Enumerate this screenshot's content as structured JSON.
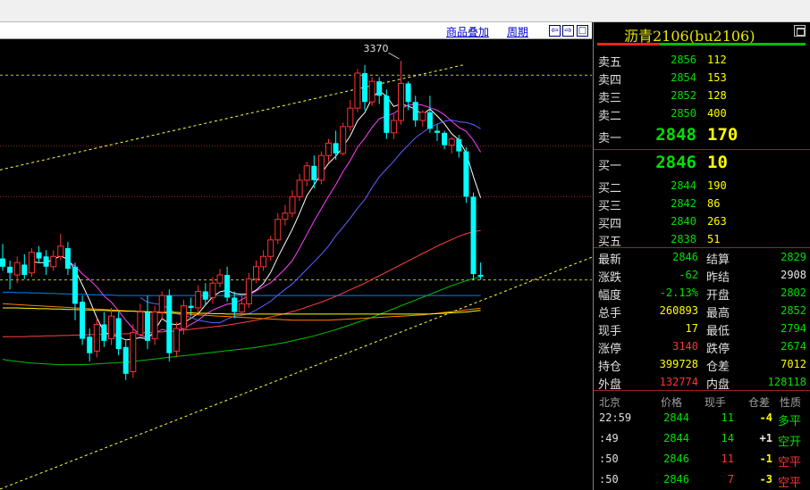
{
  "toolbar": {
    "overlay_label": "商品叠加",
    "period_label": "周期",
    "nav_buttons": [
      "⇦",
      "⇨",
      "□"
    ]
  },
  "colors": {
    "up": "#ff3232",
    "down": "#00ffff",
    "ma5": "#ffffff",
    "ma10": "#ff40ff",
    "ma20": "#6060ff",
    "ma40": "#ff4040",
    "ma60": "#00c000",
    "ma120": "#0080ff",
    "ma250": "#ff8000",
    "ma_long": "#ffff00",
    "trend": "#ffff40"
  },
  "chart_data": {
    "type": "candlestick",
    "y_range": [
      2330,
      3420
    ],
    "high_label": "3370",
    "reference_levels": [
      3335,
      3163,
      3040,
      2838
    ],
    "trend_lines": [
      {
        "name": "upper",
        "from": [
          0,
          3105
        ],
        "to": [
          64,
          3360
        ]
      },
      {
        "name": "lower",
        "from": [
          0,
          2330
        ],
        "to": [
          90,
          2950
        ]
      }
    ],
    "candles": [
      [
        2890,
        2870,
        2925,
        2860
      ],
      [
        2870,
        2855,
        2885,
        2815
      ],
      [
        2850,
        2880,
        2895,
        2830
      ],
      [
        2875,
        2850,
        2900,
        2840
      ],
      [
        2855,
        2905,
        2915,
        2845
      ],
      [
        2905,
        2890,
        2920,
        2880
      ],
      [
        2895,
        2870,
        2910,
        2850
      ],
      [
        2870,
        2895,
        2910,
        2860
      ],
      [
        2895,
        2920,
        2950,
        2885
      ],
      [
        2915,
        2865,
        2930,
        2850
      ],
      [
        2870,
        2780,
        2880,
        2740
      ],
      [
        2785,
        2695,
        2800,
        2680
      ],
      [
        2700,
        2660,
        2720,
        2640
      ],
      [
        2665,
        2730,
        2745,
        2650
      ],
      [
        2730,
        2690,
        2760,
        2675
      ],
      [
        2695,
        2750,
        2770,
        2680
      ],
      [
        2745,
        2670,
        2760,
        2655
      ],
      [
        2675,
        2610,
        2690,
        2595
      ],
      [
        2615,
        2710,
        2730,
        2600
      ],
      [
        2705,
        2760,
        2780,
        2700
      ],
      [
        2760,
        2690,
        2800,
        2670
      ],
      [
        2695,
        2760,
        2775,
        2680
      ],
      [
        2760,
        2800,
        2810,
        2740
      ],
      [
        2800,
        2660,
        2815,
        2640
      ],
      [
        2665,
        2720,
        2735,
        2650
      ],
      [
        2720,
        2775,
        2790,
        2705
      ],
      [
        2775,
        2770,
        2795,
        2750
      ],
      [
        2770,
        2810,
        2825,
        2760
      ],
      [
        2810,
        2790,
        2830,
        2775
      ],
      [
        2795,
        2830,
        2845,
        2780
      ],
      [
        2830,
        2850,
        2865,
        2820
      ],
      [
        2850,
        2795,
        2870,
        2785
      ],
      [
        2795,
        2760,
        2810,
        2745
      ],
      [
        2760,
        2780,
        2800,
        2750
      ],
      [
        2780,
        2840,
        2855,
        2770
      ],
      [
        2840,
        2870,
        2885,
        2830
      ],
      [
        2870,
        2895,
        2910,
        2860
      ],
      [
        2895,
        2935,
        2945,
        2885
      ],
      [
        2935,
        2985,
        3000,
        2925
      ],
      [
        2985,
        3000,
        3020,
        2970
      ],
      [
        3000,
        3040,
        3055,
        2990
      ],
      [
        3040,
        3080,
        3095,
        3030
      ],
      [
        3080,
        3115,
        3125,
        3065
      ],
      [
        3115,
        3080,
        3140,
        3060
      ],
      [
        3080,
        3140,
        3150,
        3070
      ],
      [
        3140,
        3170,
        3180,
        3125
      ],
      [
        3170,
        3145,
        3200,
        3130
      ],
      [
        3145,
        3210,
        3220,
        3140
      ],
      [
        3210,
        3255,
        3275,
        3200
      ],
      [
        3255,
        3340,
        3350,
        3245
      ],
      [
        3340,
        3270,
        3360,
        3250
      ],
      [
        3270,
        3320,
        3330,
        3260
      ],
      [
        3320,
        3285,
        3330,
        3265
      ],
      [
        3285,
        3195,
        3300,
        3180
      ],
      [
        3195,
        3225,
        3240,
        3180
      ],
      [
        3225,
        3315,
        3370,
        3215
      ],
      [
        3315,
        3270,
        3320,
        3250
      ],
      [
        3270,
        3225,
        3285,
        3210
      ],
      [
        3225,
        3245,
        3250,
        3210
      ],
      [
        3245,
        3205,
        3285,
        3195
      ],
      [
        3200,
        3195,
        3215,
        3175
      ],
      [
        3195,
        3165,
        3200,
        3155
      ],
      [
        3165,
        3180,
        3185,
        3145
      ],
      [
        3180,
        3150,
        3190,
        3135
      ],
      [
        3150,
        3040,
        3160,
        3025
      ],
      [
        3040,
        2852,
        3050,
        2838
      ],
      [
        2850,
        2846,
        2880,
        2838
      ]
    ],
    "moving_averages": [
      {
        "name": "MA5",
        "color": "ma5",
        "values": [
          null,
          null,
          null,
          null,
          2882,
          2880,
          2880,
          2888,
          2896,
          2888,
          2862,
          2826,
          2789,
          2746,
          2711,
          2705,
          2700,
          2692,
          2694,
          2698,
          2694,
          2716,
          2744,
          2732,
          2729,
          2734,
          2745,
          2756,
          2777,
          2797,
          2809,
          2813,
          2805,
          2803,
          2804,
          2813,
          2829,
          2856,
          2893,
          2927,
          2961,
          3000,
          3042,
          3069,
          3096,
          3121,
          3138,
          3161,
          3188,
          3224,
          3244,
          3279,
          3297,
          3284,
          3259,
          3265,
          3260,
          3252,
          3239,
          3253,
          3236,
          3217,
          3193,
          3178,
          3146,
          3089,
          3037
        ]
      },
      {
        "name": "MA10",
        "color": "ma10",
        "values": [
          null,
          null,
          null,
          null,
          null,
          null,
          null,
          null,
          null,
          2885,
          2871,
          2853,
          2838,
          2821,
          2799,
          2784,
          2763,
          2740,
          2720,
          2704,
          2697,
          2708,
          2718,
          2713,
          2713,
          2720,
          2730,
          2740,
          2754,
          2765,
          2772,
          2779,
          2781,
          2790,
          2800,
          2811,
          2821,
          2831,
          2848,
          2865,
          2885,
          2915,
          2948,
          2981,
          3011,
          3041,
          3069,
          3101,
          3128,
          3160,
          3182,
          3208,
          3229,
          3236,
          3242,
          3254,
          3262,
          3265,
          3262,
          3256,
          3250,
          3239,
          3223,
          3208,
          3199,
          3177,
          3148
        ]
      },
      {
        "name": "MA20",
        "color": "ma20",
        "values": [
          null,
          null,
          null,
          null,
          null,
          null,
          null,
          null,
          null,
          null,
          null,
          null,
          null,
          null,
          null,
          null,
          null,
          null,
          null,
          2795,
          2784,
          2780,
          2778,
          2767,
          2756,
          2752,
          2747,
          2740,
          2737,
          2734,
          2734,
          2743,
          2750,
          2752,
          2756,
          2765,
          2775,
          2786,
          2801,
          2815,
          2828,
          2846,
          2864,
          2882,
          2900,
          2920,
          2945,
          2966,
          2988,
          3012,
          3033,
          3062,
          3088,
          3107,
          3126,
          3147,
          3165,
          3183,
          3196,
          3208,
          3216,
          3223,
          3226,
          3222,
          3220,
          3215,
          3205
        ]
      },
      {
        "name": "MA40",
        "color": "ma40",
        "values": [
          2700,
          2700,
          2700,
          2700,
          2701,
          2701,
          2702,
          2702,
          2703,
          2703,
          2704,
          2704,
          2705,
          2705,
          2706,
          2706,
          2707,
          2707,
          2708,
          2709,
          2710,
          2711,
          2712,
          2713,
          2714,
          2716,
          2718,
          2720,
          2722,
          2724,
          2726,
          2728,
          2731,
          2734,
          2737,
          2740,
          2744,
          2748,
          2752,
          2756,
          2761,
          2766,
          2772,
          2778,
          2784,
          2791,
          2798,
          2806,
          2814,
          2822,
          2830,
          2839,
          2848,
          2857,
          2866,
          2875,
          2884,
          2893,
          2902,
          2911,
          2920,
          2928,
          2936,
          2944,
          2950,
          2955,
          2958
        ]
      },
      {
        "name": "MA60",
        "color": "ma60",
        "values": [
          2645,
          2642,
          2640,
          2638,
          2636,
          2635,
          2634,
          2633,
          2632,
          2632,
          2632,
          2632,
          2633,
          2634,
          2635,
          2636,
          2637,
          2638,
          2640,
          2642,
          2644,
          2646,
          2648,
          2650,
          2652,
          2654,
          2656,
          2658,
          2660,
          2662,
          2664,
          2666,
          2668,
          2670,
          2672,
          2674,
          2677,
          2680,
          2683,
          2686,
          2690,
          2694,
          2698,
          2702,
          2707,
          2712,
          2717,
          2723,
          2729,
          2735,
          2741,
          2747,
          2754,
          2761,
          2768,
          2775,
          2782,
          2789,
          2796,
          2803,
          2810,
          2817,
          2824,
          2830,
          2836,
          2841,
          2845
        ]
      },
      {
        "name": "MA120",
        "color": "ma120",
        "values": [
          2808,
          2808,
          2807,
          2807,
          2806,
          2806,
          2805,
          2805,
          2804,
          2804,
          2803,
          2803,
          2802,
          2802,
          2801,
          2801,
          2800,
          2800,
          2800,
          2800,
          2800,
          2800,
          2800,
          2800,
          2800,
          2800,
          2800,
          2800,
          2800,
          2800,
          2800,
          2800,
          2800,
          2800,
          2800,
          2800,
          2800,
          2800,
          2800,
          2800,
          2800,
          2800,
          2800,
          2800,
          2800,
          2800,
          2800,
          2800,
          2800,
          2800,
          2800,
          2800,
          2800,
          2800,
          2800,
          2800,
          2800,
          2800,
          2800,
          2800,
          2800,
          2800,
          2800,
          2800,
          2800,
          2800,
          2800
        ]
      },
      {
        "name": "MA250",
        "color": "ma250",
        "values": [
          2780,
          2779,
          2778,
          2777,
          2776,
          2775,
          2774,
          2773,
          2772,
          2771,
          2770,
          2769,
          2768,
          2767,
          2766,
          2765,
          2764,
          2763,
          2762,
          2761,
          2760,
          2759,
          2758,
          2757,
          2756,
          2755,
          2754,
          2753,
          2752,
          2751,
          2750,
          2749,
          2748,
          2747,
          2746,
          2745,
          2744,
          2743,
          2742,
          2741,
          2740,
          2740,
          2740,
          2740,
          2740,
          2740,
          2741,
          2742,
          2743,
          2744,
          2745,
          2746,
          2747,
          2748,
          2749,
          2750,
          2751,
          2752,
          2753,
          2755,
          2757,
          2759,
          2761,
          2763,
          2765,
          2767,
          2769
        ]
      },
      {
        "name": "MA_long",
        "color": "ma_long",
        "values": [
          2770,
          2770,
          2770,
          2769,
          2769,
          2768,
          2768,
          2767,
          2767,
          2766,
          2766,
          2765,
          2765,
          2764,
          2764,
          2763,
          2763,
          2762,
          2762,
          2761,
          2761,
          2760,
          2760,
          2759,
          2759,
          2758,
          2758,
          2757,
          2757,
          2756,
          2756,
          2755,
          2755,
          2755,
          2755,
          2755,
          2755,
          2755,
          2755,
          2755,
          2755,
          2755,
          2755,
          2755,
          2755,
          2755,
          2755,
          2755,
          2755,
          2755,
          2755,
          2755,
          2755,
          2755,
          2755,
          2755,
          2755,
          2755,
          2755,
          2755,
          2756,
          2757,
          2758,
          2759,
          2760,
          2762,
          2764
        ]
      }
    ]
  },
  "quote": {
    "title": "沥青2106(bu2106)",
    "asks": [
      {
        "label": "卖五",
        "price": "2856",
        "vol": "112"
      },
      {
        "label": "卖四",
        "price": "2854",
        "vol": "153"
      },
      {
        "label": "卖三",
        "price": "2852",
        "vol": "128"
      },
      {
        "label": "卖二",
        "price": "2850",
        "vol": "400"
      }
    ],
    "ask1": {
      "label": "卖一",
      "price": "2848",
      "vol": "170"
    },
    "bid1": {
      "label": "买一",
      "price": "2846",
      "vol": "10"
    },
    "bids": [
      {
        "label": "买二",
        "price": "2844",
        "vol": "190"
      },
      {
        "label": "买三",
        "price": "2842",
        "vol": "86"
      },
      {
        "label": "买四",
        "price": "2840",
        "vol": "263"
      },
      {
        "label": "买五",
        "price": "2838",
        "vol": "51"
      }
    ],
    "stats": [
      {
        "label": "最新",
        "value": "2846",
        "color": "green"
      },
      {
        "label": "结算",
        "value": "2829",
        "color": "green"
      },
      {
        "label": "涨跌",
        "value": "-62",
        "color": "green"
      },
      {
        "label": "昨结",
        "value": "2908",
        "color": "white"
      },
      {
        "label": "幅度",
        "value": "-2.13%",
        "color": "green"
      },
      {
        "label": "开盘",
        "value": "2802",
        "color": "green"
      },
      {
        "label": "总手",
        "value": "260893",
        "color": "yellow"
      },
      {
        "label": "最高",
        "value": "2852",
        "color": "green"
      },
      {
        "label": "现手",
        "value": "17",
        "color": "yellow"
      },
      {
        "label": "最低",
        "value": "2794",
        "color": "green"
      },
      {
        "label": "涨停",
        "value": "3140",
        "color": "red"
      },
      {
        "label": "跌停",
        "value": "2674",
        "color": "green"
      },
      {
        "label": "持仓",
        "value": "399728",
        "color": "yellow"
      },
      {
        "label": "仓差",
        "value": "7012",
        "color": "yellow"
      },
      {
        "label": "外盘",
        "value": "132774",
        "color": "red"
      },
      {
        "label": "内盘",
        "value": "128118",
        "color": "green"
      }
    ],
    "tick_header": [
      "北京",
      "价格",
      "现手",
      "仓差",
      "性质"
    ],
    "ticks": [
      {
        "time": "22:59",
        "price": "2844",
        "qty": "11",
        "oi": "-4",
        "nature": "多平",
        "qty_color": "green",
        "oi_color": "yellow",
        "nature_color": "green"
      },
      {
        "time": ":49",
        "price": "2844",
        "qty": "14",
        "oi": "+1",
        "nature": "空开",
        "qty_color": "green",
        "oi_color": "white",
        "nature_color": "green"
      },
      {
        "time": ":50",
        "price": "2846",
        "qty": "11",
        "oi": "-1",
        "nature": "空平",
        "qty_color": "red",
        "oi_color": "yellow",
        "nature_color": "red"
      },
      {
        "time": ":50",
        "price": "2846",
        "qty": "7",
        "oi": "-3",
        "nature": "空平",
        "qty_color": "red",
        "oi_color": "yellow",
        "nature_color": "red"
      }
    ]
  }
}
